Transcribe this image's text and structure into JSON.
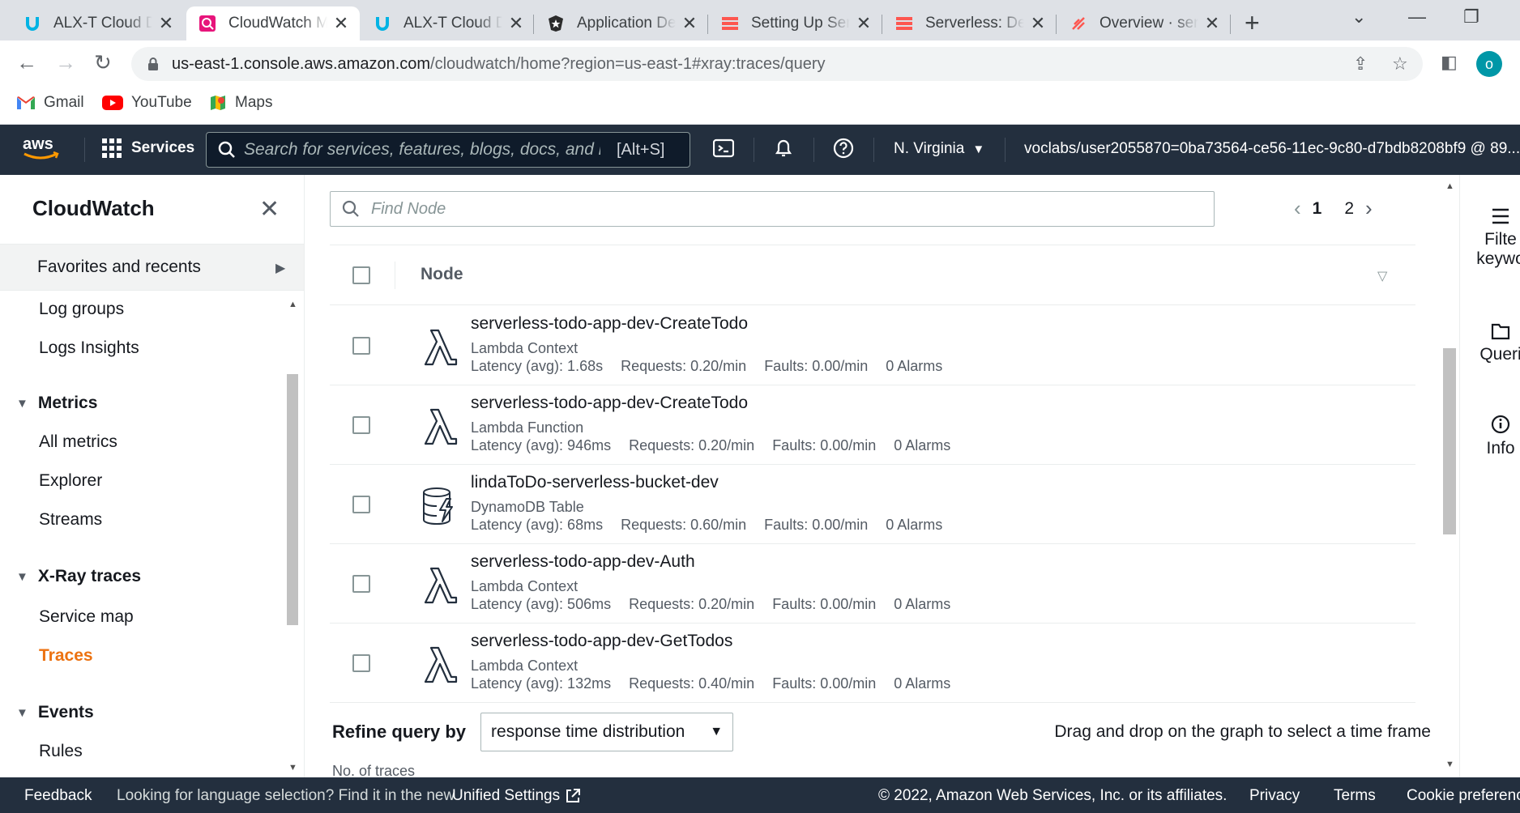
{
  "browser": {
    "tabs": [
      {
        "title": "ALX-T Cloud D",
        "favicon": "udacity-icon"
      },
      {
        "title": "CloudWatch M",
        "favicon": "cloudwatch-icon",
        "active": true
      },
      {
        "title": "ALX-T Cloud D",
        "favicon": "udacity-icon"
      },
      {
        "title": "Application De",
        "favicon": "auth0-icon"
      },
      {
        "title": "Setting Up Sen",
        "favicon": "serverless-icon"
      },
      {
        "title": "Serverless: Dev",
        "favicon": "serverless-icon"
      },
      {
        "title": "Overview · serv",
        "favicon": "serverless-dashboard-icon"
      }
    ],
    "url_host": "us-east-1.console.aws.amazon.com",
    "url_path": "/cloudwatch/home?region=us-east-1#xray:traces/query",
    "profile_initial": "o",
    "bookmarks": [
      {
        "label": "Gmail",
        "icon": "gmail-icon"
      },
      {
        "label": "YouTube",
        "icon": "youtube-icon"
      },
      {
        "label": "Maps",
        "icon": "maps-icon"
      }
    ]
  },
  "aws_nav": {
    "services_label": "Services",
    "search_placeholder": "Search for services, features, blogs, docs, and m",
    "search_shortcut": "[Alt+S]",
    "region": "N. Virginia",
    "account": "voclabs/user2055870=0ba73564-ce56-11ec-9c80-d7bdb8208bf9 @ 89..."
  },
  "sidebar": {
    "title": "CloudWatch",
    "favorites_label": "Favorites and recents",
    "logs_items": [
      "Log groups",
      "Logs Insights"
    ],
    "metrics_title": "Metrics",
    "metrics_items": [
      "All metrics",
      "Explorer",
      "Streams"
    ],
    "xray_title": "X-Ray traces",
    "xray_items": [
      "Service map",
      "Traces"
    ],
    "events_title": "Events",
    "events_items": [
      "Rules"
    ]
  },
  "main": {
    "find_placeholder": "Find Node",
    "pager": {
      "pages": [
        "1",
        "2"
      ],
      "current": "1"
    },
    "table_header": "Node",
    "rows": [
      {
        "name": "serverless-todo-app-dev-CreateTodo",
        "type": "Lambda Context",
        "icon": "lambda-icon",
        "latency": "Latency (avg): 1.68s",
        "requests": "Requests: 0.20/min",
        "faults": "Faults: 0.00/min",
        "alarms": "0 Alarms"
      },
      {
        "name": "serverless-todo-app-dev-CreateTodo",
        "type": "Lambda Function",
        "icon": "lambda-icon",
        "latency": "Latency (avg): 946ms",
        "requests": "Requests: 0.20/min",
        "faults": "Faults: 0.00/min",
        "alarms": "0 Alarms"
      },
      {
        "name": "lindaToDo-serverless-bucket-dev",
        "type": "DynamoDB Table",
        "icon": "dynamodb-icon",
        "latency": "Latency (avg): 68ms",
        "requests": "Requests: 0.60/min",
        "faults": "Faults: 0.00/min",
        "alarms": "0 Alarms"
      },
      {
        "name": "serverless-todo-app-dev-Auth",
        "type": "Lambda Context",
        "icon": "lambda-icon",
        "latency": "Latency (avg): 506ms",
        "requests": "Requests: 0.20/min",
        "faults": "Faults: 0.00/min",
        "alarms": "0 Alarms"
      },
      {
        "name": "serverless-todo-app-dev-GetTodos",
        "type": "Lambda Context",
        "icon": "lambda-icon",
        "latency": "Latency (avg): 132ms",
        "requests": "Requests: 0.40/min",
        "faults": "Faults: 0.00/min",
        "alarms": "0 Alarms"
      }
    ],
    "refine_label": "Refine query by",
    "refine_value": "response time distribution",
    "drag_tip": "Drag and drop on the graph to select a time frame",
    "traces_label": "No. of traces"
  },
  "rail": {
    "filter_label_1": "Filte",
    "filter_label_2": "keywo",
    "queries_label": "Queri",
    "info_label": "Info"
  },
  "footer": {
    "feedback": "Feedback",
    "language_prompt": "Looking for language selection? Find it in the new",
    "unified_settings": "Unified Settings",
    "copyright": "© 2022, Amazon Web Services, Inc. or its affiliates.",
    "privacy": "Privacy",
    "terms": "Terms",
    "cookie": "Cookie preferenc"
  },
  "colors": {
    "aws_nav_bg": "#232f3e",
    "active_link": "#ec7211",
    "footer_bg": "#232f3e"
  }
}
